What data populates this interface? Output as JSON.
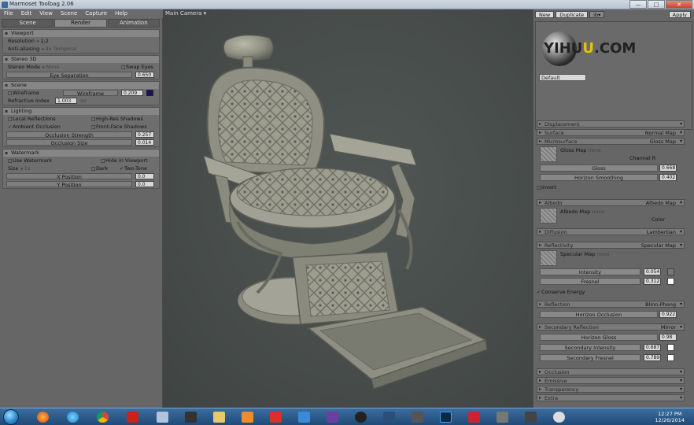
{
  "window": {
    "title": "Marmoset Toolbag 2.06",
    "min": "—",
    "max": "□",
    "close": "✕"
  },
  "menu": [
    "File",
    "Edit",
    "View",
    "Scene",
    "Capture",
    "Help"
  ],
  "tabs": [
    "Scene",
    "Render",
    "Animation"
  ],
  "left": {
    "viewport": {
      "title": "Viewport",
      "resolution_label": "Resolution",
      "resolution_value": "1:2",
      "aa_label": "Anti-aliasing",
      "aa_value": "4x Temporal"
    },
    "stereo": {
      "title": "Stereo 3D",
      "mode_label": "Stereo Mode",
      "mode_value": "None",
      "swap_eyes": "Swap Eyes",
      "eye_sep_label": "Eye Separation",
      "eye_sep_value": "0.650"
    },
    "scene": {
      "title": "Scene",
      "wireframe_check": "Wireframe",
      "wireframe_slider": "Wireframe",
      "wireframe_value": "0.209",
      "wire_color": "#1a1060",
      "refr_label": "Refractive Index",
      "refr_value": "1.003",
      "refr_suffix": "ior"
    },
    "lighting": {
      "title": "Lighting",
      "local_refl": "Local Reflections",
      "hires_shadows": "High-Res Shadows",
      "ambient_occ": "Ambient Occlusion",
      "front_face": "Front-Face Shadows",
      "occ_strength_label": "Occlusion Strength",
      "occ_strength_value": "0.257",
      "occ_size_label": "Occlusion Size",
      "occ_size_value": "0.014"
    },
    "watermark": {
      "title": "Watermark",
      "use_watermark": "Use Watermark",
      "hide_viewport": "Hide in Viewport",
      "size_label": "Size",
      "size_value": "1x",
      "dark": "Dark",
      "two_tone": "Two-Tone",
      "xpos_label": "X Position",
      "xpos_value": "0.0",
      "ypos_label": "Y Position",
      "ypos_value": "0.0"
    }
  },
  "viewport_label": "Main Camera ▾",
  "right": {
    "toolbar": {
      "new": "New",
      "duplicate": "Duplicate",
      "dropdown": "ib▾",
      "apply": "Apply"
    },
    "material_name": "Default",
    "watermark_text": {
      "a": "YIHU",
      "b": "U",
      "c": ".COM"
    },
    "sections": [
      {
        "label": "Displacement",
        "value": ""
      },
      {
        "label": "Surface",
        "value": "Normal Map"
      },
      {
        "label": "Microsurface",
        "value": "Gloss Map"
      }
    ],
    "gloss_map": {
      "label": "Gloss Map",
      "value": "none",
      "channel_label": "Channel",
      "channel_value": "R",
      "gloss_label": "Gloss",
      "gloss_value": "0.668",
      "horizon_label": "Horizon Smoothing",
      "horizon_value": "0.402",
      "invert": "Invert"
    },
    "albedo": {
      "section": "Albedo",
      "section_value": "Albedo Map",
      "map_label": "Albedo Map",
      "map_value": "none",
      "color_label": "Color"
    },
    "diffusion": {
      "section": "Diffusion",
      "value": "Lambertian"
    },
    "reflectivity": {
      "section": "Reflectivity",
      "value": "Specular Map",
      "map_label": "Specular Map",
      "map_value": "none",
      "intensity_label": "Intensity",
      "intensity_value": "0.054",
      "fresnel_label": "Fresnel",
      "fresnel_value": "0.312",
      "conserve": "Conserve Energy"
    },
    "reflection": {
      "section": "Reflection",
      "value": "Blinn-Phong",
      "horizon_label": "Horizon Occlusion",
      "horizon_value": "0.922"
    },
    "secondary": {
      "section": "Secondary Reflection",
      "value": "Mirror",
      "gloss_label": "Horizon Gloss",
      "gloss_value": "0.98",
      "intensity_label": "Secondary Intensity",
      "intensity_value": "0.687",
      "fresnel_label": "Secondary Fresnel",
      "fresnel_value": "0.789"
    },
    "bottom_sections": [
      "Occlusion",
      "Emissive",
      "Transparency",
      "Extra"
    ]
  },
  "taskbar": {
    "time": "12:27 PM",
    "date": "12/26/2014"
  }
}
